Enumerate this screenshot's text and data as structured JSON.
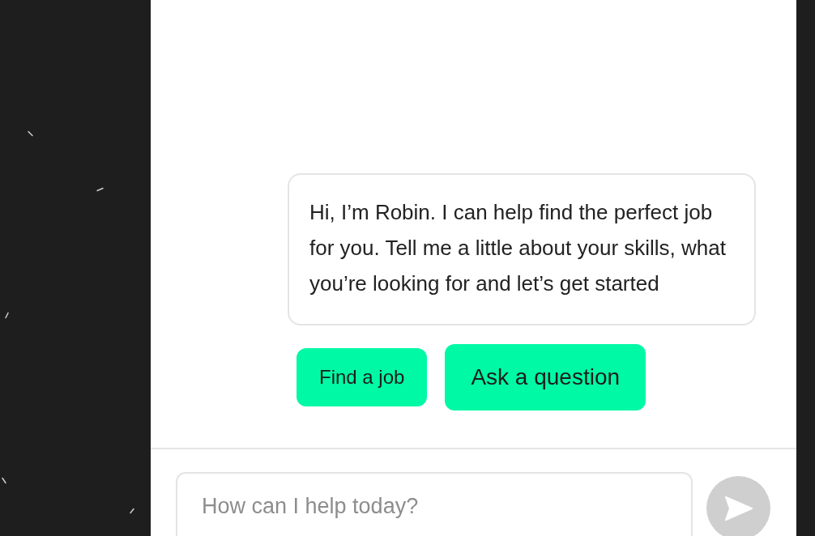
{
  "chat": {
    "messages": [
      {
        "text": "Hi, I’m Robin. I can help find the perfect job for you. Tell me a little about your skills, what you’re looking for and let’s get started"
      }
    ],
    "quick_replies": [
      {
        "label": "Find a job",
        "emphasized": false
      },
      {
        "label": "Ask a question",
        "emphasized": true
      }
    ]
  },
  "composer": {
    "placeholder": "How can I help today?",
    "send_disabled": true
  }
}
